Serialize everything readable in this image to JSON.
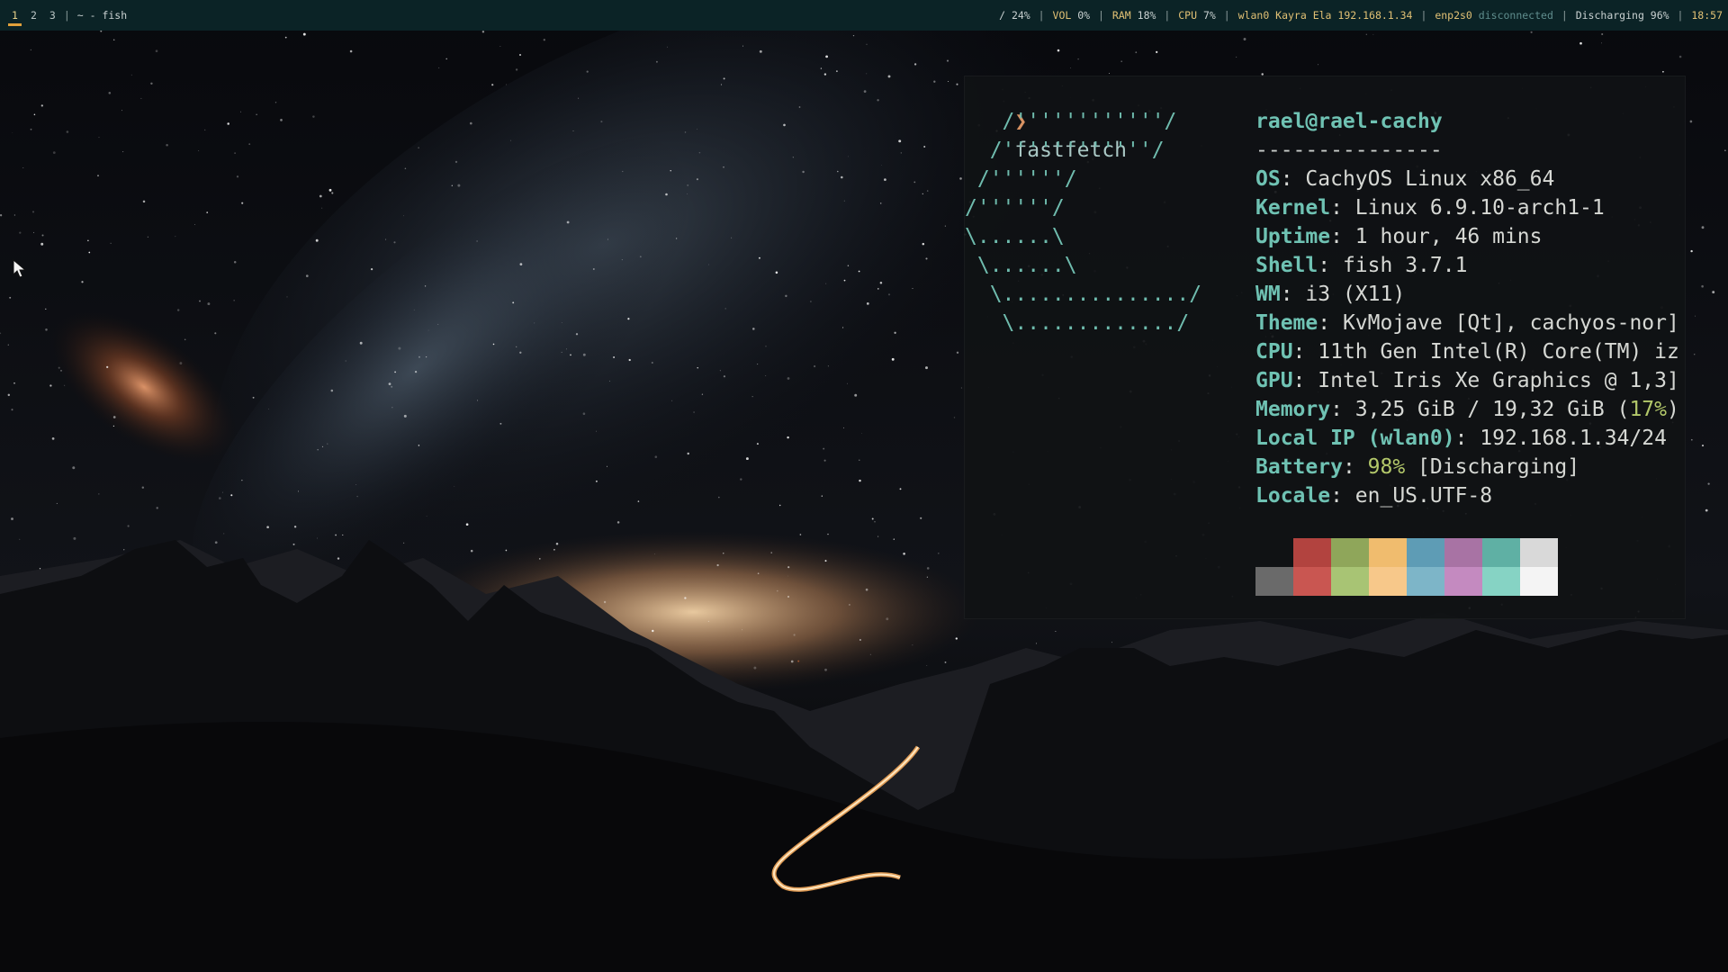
{
  "bar": {
    "workspaces": [
      "1",
      "2",
      "3"
    ],
    "window_title": "~ - fish",
    "disk": "/ 24%",
    "vol_label": "VOL",
    "vol_value": "0%",
    "ram_label": "RAM",
    "ram_value": "18%",
    "cpu_label": "CPU",
    "cpu_value": "7%",
    "wlan": "wlan0 Kayra Ela 192.168.1.34",
    "enp_label": "enp2s0",
    "enp_status": "disconnected",
    "battery": "Discharging 96%",
    "clock": "18:57",
    "colors": {
      "bar_bg": "#0b2326",
      "accent": "#e0c074",
      "active_underline": "#e0a13b"
    }
  },
  "terminal": {
    "prompt_symbol": "❯",
    "command": "fastfetch",
    "logo_lines": [
      "   /''''''''''''/",
      "  /''''''''''''/",
      " /''''''/",
      "/''''''/",
      "\\......\\",
      " \\......\\",
      "  \\.............../",
      "   \\............./"
    ],
    "user_host": "rael@rael-cachy",
    "separator": "---------------",
    "info": [
      {
        "key": "OS",
        "value": "CachyOS Linux x86_64"
      },
      {
        "key": "Kernel",
        "value": "Linux 6.9.10-arch1-1"
      },
      {
        "key": "Uptime",
        "value": "1 hour, 46 mins"
      },
      {
        "key": "Shell",
        "value": "fish 3.7.1"
      },
      {
        "key": "WM",
        "value": "i3 (X11)"
      },
      {
        "key": "Theme",
        "value": "KvMojave [Qt], cachyos-nor]"
      },
      {
        "key": "CPU",
        "value": "11th Gen Intel(R) Core(TM) iz"
      },
      {
        "key": "GPU",
        "value": "Intel Iris Xe Graphics @ 1,3]"
      },
      {
        "key": "Memory",
        "value": "3,25 GiB / 19,32 GiB (",
        "highlight": "17%",
        "suffix": ")"
      },
      {
        "key": "Local IP (wlan0)",
        "value": "192.168.1.34/24"
      },
      {
        "key": "Battery",
        "value": "",
        "highlight": "98%",
        "suffix": " [Discharging]"
      },
      {
        "key": "Locale",
        "value": "en_US.UTF-8"
      }
    ],
    "palette_top": [
      "#101214",
      "#b2433f",
      "#8fa65a",
      "#f0bc6e",
      "#5e9cb5",
      "#a873a4",
      "#5fb0a4",
      "#d9d9d9"
    ],
    "palette_bottom": [
      "#6a6a6a",
      "#c95651",
      "#a8c474",
      "#f7c88a",
      "#7db5c8",
      "#c48ac0",
      "#86d3c4",
      "#f4f4f4"
    ]
  }
}
